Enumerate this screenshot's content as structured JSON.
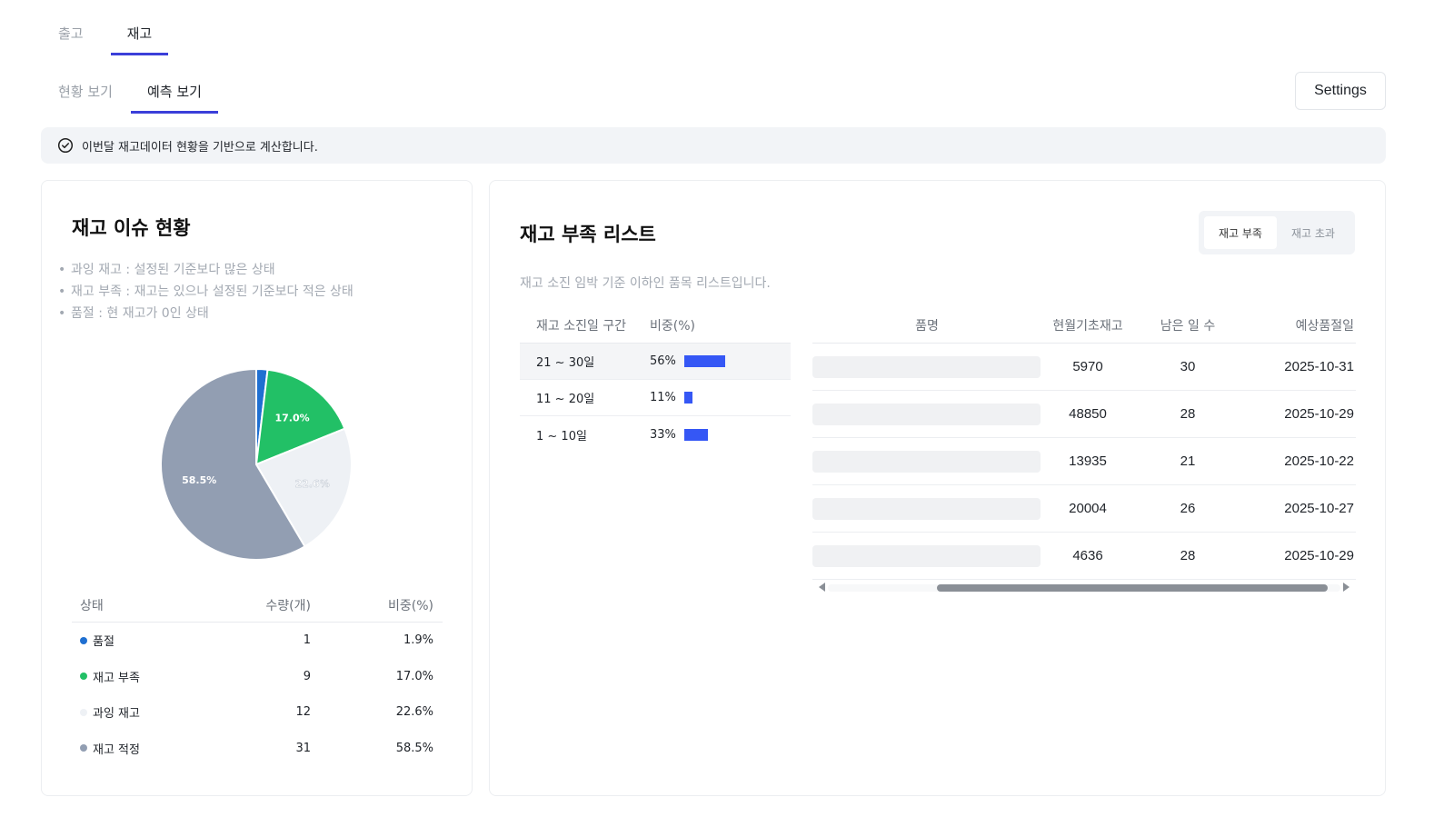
{
  "tabs": [
    {
      "label": "출고",
      "active": false
    },
    {
      "label": "재고",
      "active": true
    }
  ],
  "subtabs": [
    {
      "label": "현황 보기",
      "active": false
    },
    {
      "label": "예측 보기",
      "active": true
    }
  ],
  "settings_label": "Settings",
  "notice": {
    "icon": "check-circle-icon",
    "text": "이번달 재고데이터 현황을 기반으로 계산합니다."
  },
  "issue_card": {
    "title": "재고 이슈 현황",
    "notes": [
      "과잉 재고 : 설정된 기준보다 많은 상태",
      "재고 부족 : 재고는 있으나 설정된 기준보다 적은 상태",
      "품절 : 현 재고가 0인 상태"
    ],
    "table_headers": [
      "상태",
      "수량(개)",
      "비중(%)"
    ],
    "rows": [
      {
        "status": "품절",
        "qty": "1",
        "pct": "1.9%",
        "color": "#1f6fd1"
      },
      {
        "status": "재고 부족",
        "qty": "9",
        "pct": "17.0%",
        "color": "#22c066"
      },
      {
        "status": "과잉 재고",
        "qty": "12",
        "pct": "22.6%",
        "color": "#eef1f5"
      },
      {
        "status": "재고 적정",
        "qty": "31",
        "pct": "58.5%",
        "color": "#929eb2"
      }
    ]
  },
  "chart_data": {
    "type": "pie",
    "labels": [
      "품절",
      "재고 부족",
      "과잉 재고",
      "재고 적정"
    ],
    "values": [
      1.9,
      17.0,
      22.6,
      58.5
    ],
    "slice_labels": [
      "",
      "17.0%",
      "22.6%",
      "58.5%"
    ],
    "colors": [
      "#1f6fd1",
      "#22c066",
      "#eef1f5",
      "#929eb2"
    ]
  },
  "shortage_card": {
    "title": "재고 부족 리스트",
    "toggle": [
      {
        "label": "재고 부족",
        "active": true
      },
      {
        "label": "재고 초과",
        "active": false
      }
    ],
    "description": "재고 소진 임박 기준 이하인 품목 리스트입니다.",
    "range_headers": [
      "재고 소진일 구간",
      "비중(%)"
    ],
    "ranges": [
      {
        "label": "21 ~ 30일",
        "pct": "56%",
        "value": 56
      },
      {
        "label": "11 ~ 20일",
        "pct": "11%",
        "value": 11
      },
      {
        "label": "1 ~ 10일",
        "pct": "33%",
        "value": 33
      }
    ],
    "item_headers": [
      "품명",
      "현월기초재고",
      "남은 일 수",
      "예상품절일"
    ],
    "items": [
      {
        "stock": "5970",
        "days": "30",
        "date": "2025-10-31"
      },
      {
        "stock": "48850",
        "days": "28",
        "date": "2025-10-29"
      },
      {
        "stock": "13935",
        "days": "21",
        "date": "2025-10-22"
      },
      {
        "stock": "20004",
        "days": "26",
        "date": "2025-10-27"
      },
      {
        "stock": "4636",
        "days": "28",
        "date": "2025-10-29"
      }
    ]
  }
}
